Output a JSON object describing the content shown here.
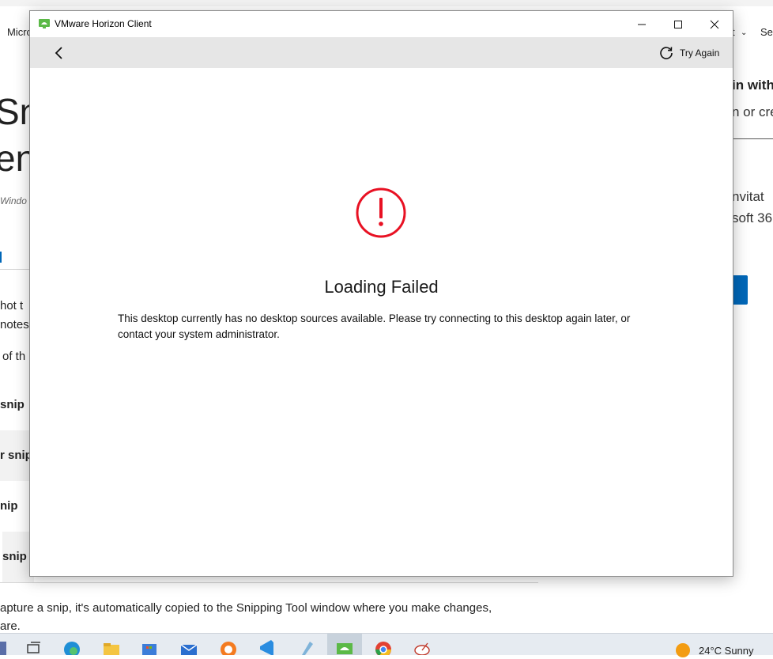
{
  "background_page": {
    "nav_left": "Micro",
    "nav_right_1": "t",
    "nav_right_2": "Se",
    "heading_line1": "Sn",
    "heading_line2": "en",
    "meta_italic": "Windo",
    "left_text_1": "hot t",
    "left_text_2": "notes,",
    "left_text_3": "of th",
    "rows": [
      "snip",
      "r snip",
      "nip",
      "snip"
    ],
    "right_title": "in with",
    "right_text_1": "n or cre",
    "right_text_2": "nvitat",
    "right_text_3": "soft 36",
    "bottom_text_1": "apture a snip, it's automatically copied to the Snipping Tool window where you make changes,",
    "bottom_text_2": "are."
  },
  "window": {
    "title": "VMware Horizon Client",
    "controls": {
      "minimize": "minimize",
      "maximize": "maximize",
      "close": "close"
    },
    "toolbar": {
      "back_icon": "chevron-left-icon",
      "try_again_label": "Try Again",
      "try_again_icon": "refresh-icon"
    },
    "error": {
      "icon": "error-circle-icon",
      "title": "Loading Failed",
      "message": "This desktop currently has no desktop sources available. Please try connecting to this desktop again later, or contact your system administrator."
    }
  },
  "taskbar": {
    "items": [
      "task-view-icon",
      "edge-icon",
      "file-explorer-icon",
      "store-icon",
      "mail-icon",
      "avast-icon",
      "vscode-icon",
      "pen-icon",
      "horizon-icon",
      "chrome-icon",
      "satellite-icon"
    ],
    "weather": "24°C  Sunny"
  },
  "colors": {
    "error_red": "#e81123",
    "accent_blue": "#0067b8",
    "toolbar_gray": "#e6e6e6",
    "horizon_green": "#5bb947"
  }
}
